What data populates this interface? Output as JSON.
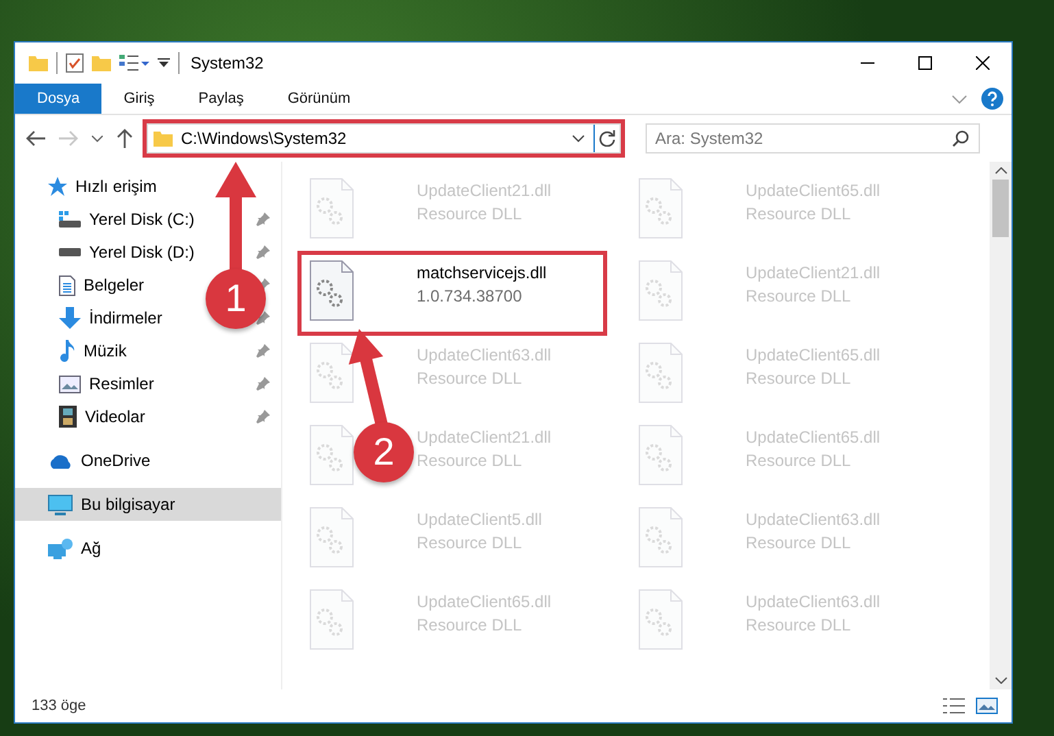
{
  "window": {
    "title": "System32"
  },
  "ribbon_tabs": [
    {
      "label": "Dosya",
      "selected": true
    },
    {
      "label": "Giriş",
      "selected": false
    },
    {
      "label": "Paylaş",
      "selected": false
    },
    {
      "label": "Görünüm",
      "selected": false
    }
  ],
  "address_bar": {
    "value": "C:\\Windows\\System32",
    "highlighted": true
  },
  "search": {
    "placeholder": "Ara: System32"
  },
  "sidebar": {
    "items": [
      {
        "label": "Hızlı erişim",
        "kind": "star",
        "selected": false,
        "children": [
          {
            "label": "Yerel Disk (C:)",
            "kind": "system-drive",
            "pinned": true,
            "selected": false
          },
          {
            "label": "Yerel Disk (D:)",
            "kind": "drive",
            "pinned": true,
            "selected": false
          },
          {
            "label": "Belgeler",
            "kind": "documents",
            "pinned": true,
            "selected": false
          },
          {
            "label": "İndirmeler",
            "kind": "downloads",
            "pinned": true,
            "selected": false
          },
          {
            "label": "Müzik",
            "kind": "music",
            "pinned": true,
            "selected": false
          },
          {
            "label": "Resimler",
            "kind": "pictures",
            "pinned": true,
            "selected": false
          },
          {
            "label": "Videolar",
            "kind": "videos",
            "pinned": true,
            "selected": false
          }
        ]
      },
      {
        "label": "OneDrive",
        "kind": "cloud",
        "selected": false
      },
      {
        "label": "Bu bilgisayar",
        "kind": "computer",
        "selected": true
      },
      {
        "label": "Ağ",
        "kind": "network",
        "selected": false
      }
    ]
  },
  "files": [
    {
      "name": "UpdateClient21.dll",
      "detail": "Resource DLL",
      "dimmed": true,
      "highlighted": false
    },
    {
      "name": "UpdateClient65.dll",
      "detail": "Resource DLL",
      "dimmed": true,
      "highlighted": false
    },
    {
      "name": "matchservicejs.dll",
      "detail": "1.0.734.38700",
      "dimmed": false,
      "highlighted": true
    },
    {
      "name": "UpdateClient21.dll",
      "detail": "Resource DLL",
      "dimmed": true,
      "highlighted": false
    },
    {
      "name": "UpdateClient63.dll",
      "detail": "Resource DLL",
      "dimmed": true,
      "highlighted": false
    },
    {
      "name": "UpdateClient65.dll",
      "detail": "Resource DLL",
      "dimmed": true,
      "highlighted": false
    },
    {
      "name": "UpdateClient21.dll",
      "detail": "Resource DLL",
      "dimmed": true,
      "highlighted": false
    },
    {
      "name": "UpdateClient65.dll",
      "detail": "Resource DLL",
      "dimmed": true,
      "highlighted": false
    },
    {
      "name": "UpdateClient5.dll",
      "detail": "Resource DLL",
      "dimmed": true,
      "highlighted": false
    },
    {
      "name": "UpdateClient63.dll",
      "detail": "Resource DLL",
      "dimmed": true,
      "highlighted": false
    },
    {
      "name": "UpdateClient65.dll",
      "detail": "Resource DLL",
      "dimmed": true,
      "highlighted": false
    },
    {
      "name": "UpdateClient63.dll",
      "detail": "Resource DLL",
      "dimmed": true,
      "highlighted": false
    }
  ],
  "status_bar": {
    "item_count": "133 öge"
  },
  "annotations": [
    {
      "number": "1"
    },
    {
      "number": "2"
    }
  ]
}
